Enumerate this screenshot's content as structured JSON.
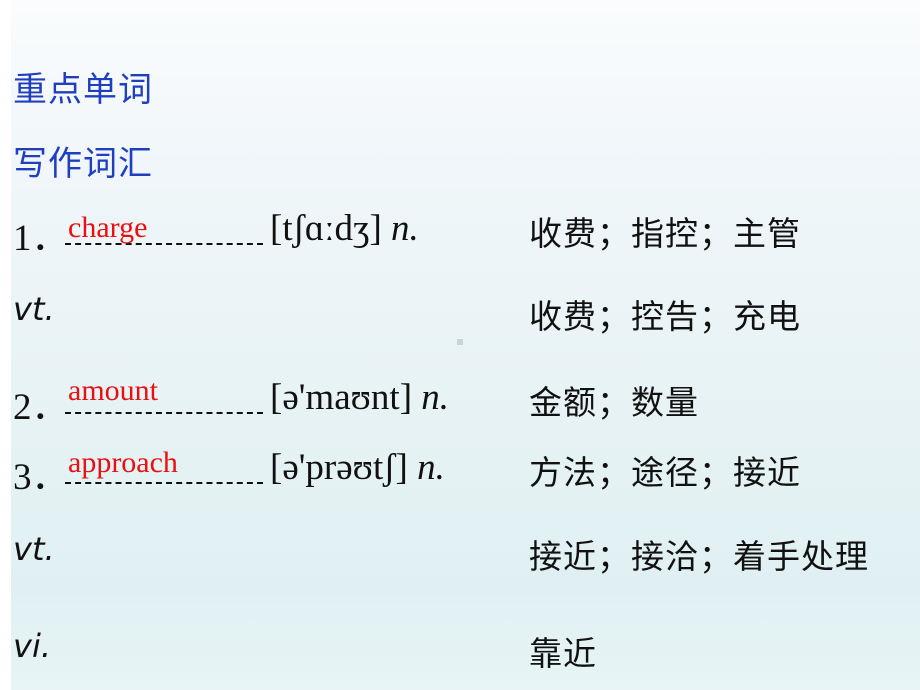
{
  "headings": {
    "section": "重点单词",
    "subsection": "写作词汇"
  },
  "entries": [
    {
      "number": "1．",
      "answer": "charge",
      "phonetic": "[tʃɑːdʒ]",
      "pos": "n.",
      "meaning": "收费；指控；主管",
      "extra": [
        {
          "pos": "vt.",
          "meaning": "收费；控告；充电"
        }
      ]
    },
    {
      "number": "2．",
      "answer": "amount",
      "phonetic": "[ə'maʊnt]",
      "pos": "n.",
      "meaning": "金额；数量",
      "extra": []
    },
    {
      "number": "3．",
      "answer": "approach",
      "phonetic": "[ə'prəʊtʃ]",
      "pos": "n.",
      "meaning": "方法；途径；接近",
      "extra": [
        {
          "pos": "vt.",
          "meaning": "接近；接洽；着手处理"
        },
        {
          "pos": "vi.",
          "meaning": "靠近"
        }
      ]
    }
  ]
}
